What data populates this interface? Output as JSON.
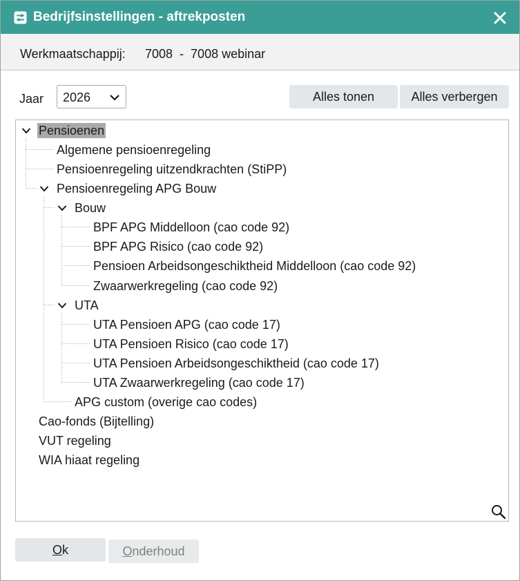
{
  "window": {
    "title": "Bedrijfsinstellingen - aftrekposten",
    "accent_color": "#3b9e96",
    "title_icon": "settings-sliders-icon",
    "close_icon": "close-icon"
  },
  "company": {
    "label": "Werkmaatschappij:",
    "value": "7008  -  7008 webinar"
  },
  "filter": {
    "year_label": "Jaar",
    "year_value": "2026",
    "show_all_label": "Alles tonen",
    "hide_all_label": "Alles verbergen"
  },
  "tree": {
    "root": {
      "label": "Pensioenen",
      "expanded": true,
      "selected": true,
      "children": [
        {
          "label": "Algemene pensioenregeling"
        },
        {
          "label": "Pensioenregeling uitzendkrachten (StiPP)"
        },
        {
          "label": "Pensioenregeling APG Bouw",
          "expanded": true,
          "children": [
            {
              "label": "Bouw",
              "expanded": true,
              "children": [
                {
                  "label": "BPF APG Middelloon (cao code 92)"
                },
                {
                  "label": "BPF APG Risico (cao code 92)"
                },
                {
                  "label": "Pensioen Arbeidsongeschiktheid Middelloon (cao code 92)"
                },
                {
                  "label": "Zwaarwerkregeling (cao code 92)"
                }
              ]
            },
            {
              "label": "UTA",
              "expanded": true,
              "children": [
                {
                  "label": "UTA Pensioen APG (cao code 17)"
                },
                {
                  "label": "UTA Pensioen Risico (cao code 17)"
                },
                {
                  "label": "UTA Pensioen Arbeidsongeschiktheid (cao code 17)"
                },
                {
                  "label": "UTA Zwaarwerkregeling (cao code 17)"
                }
              ]
            },
            {
              "label": "APG custom (overige cao codes)"
            }
          ]
        }
      ]
    },
    "others": [
      {
        "label": "Cao-fonds (Bijtelling)"
      },
      {
        "label": "VUT regeling"
      },
      {
        "label": "WIA hiaat regeling"
      }
    ],
    "search_icon": "search-icon"
  },
  "footer": {
    "ok_mnemonic": "O",
    "ok_rest": "k",
    "maintenance_mnemonic": "O",
    "maintenance_rest": "nderhoud"
  }
}
